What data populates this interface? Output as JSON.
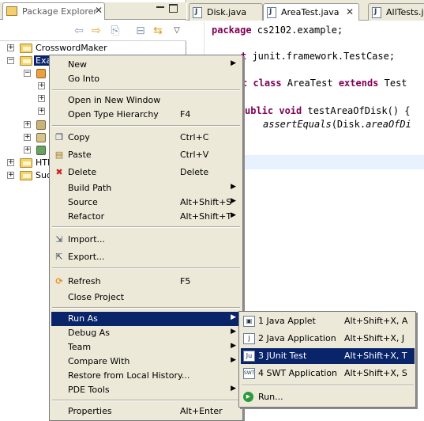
{
  "package_explorer": {
    "tab_label": "Package Explorer",
    "close_glyph": "✕",
    "toolbar_icons": [
      "back-arrow-icon",
      "forward-arrow-icon",
      "up-icon",
      "collapse-all-icon",
      "link-editor-icon",
      "view-menu-icon"
    ],
    "tree": [
      {
        "label": "CrosswordMaker",
        "expand": "+"
      },
      {
        "label": "Exa",
        "expand": "−",
        "selected": true
      },
      {
        "label": "HTD",
        "expand": "+"
      },
      {
        "label": "Suc",
        "expand": "+"
      }
    ]
  },
  "editor": {
    "tabs": [
      {
        "label": "Disk.java"
      },
      {
        "label": "AreaTest.java",
        "active": true,
        "close": "✕"
      },
      {
        "label": "AllTests.ja"
      }
    ],
    "code": {
      "line1_kw": "package",
      "line1_rest": " cs2102.example;",
      "line2_kw": "t",
      "line2_rest": " junit.framework.TestCase;",
      "line3_kw": "c class",
      "line3_mid": " AreaTest ",
      "line3_kw2": "extends",
      "line3_rest": " Test",
      "line4_kw": "ublic void",
      "line4_rest": " testAreaOfDisk() {",
      "line5_it": "assertEquals",
      "line5_rest": "(Disk.",
      "line5_it2": "areaOfDi"
    }
  },
  "context_menu": {
    "items": [
      {
        "label": "New",
        "submenu": true
      },
      {
        "label": "Go Into"
      },
      {
        "label": "Open in New Window"
      },
      {
        "label": "Open Type Hierarchy",
        "accel": "F4"
      },
      {
        "label": "Copy",
        "accel": "Ctrl+C",
        "icon": "copy-icon"
      },
      {
        "label": "Paste",
        "accel": "Ctrl+V",
        "icon": "paste-icon"
      },
      {
        "label": "Delete",
        "accel": "Delete",
        "icon": "delete-icon"
      },
      {
        "label": "Build Path",
        "submenu": true
      },
      {
        "label": "Source",
        "accel": "Alt+Shift+S",
        "submenu": true
      },
      {
        "label": "Refactor",
        "accel": "Alt+Shift+T",
        "submenu": true
      },
      {
        "label": "Import...",
        "icon": "import-icon"
      },
      {
        "label": "Export...",
        "icon": "export-icon"
      },
      {
        "label": "Refresh",
        "accel": "F5",
        "icon": "refresh-icon"
      },
      {
        "label": "Close Project"
      },
      {
        "label": "Run As",
        "submenu": true,
        "highlighted": true
      },
      {
        "label": "Debug As",
        "submenu": true
      },
      {
        "label": "Team",
        "submenu": true
      },
      {
        "label": "Compare With",
        "submenu": true
      },
      {
        "label": "Restore from Local History..."
      },
      {
        "label": "PDE Tools",
        "submenu": true
      },
      {
        "label": "Properties",
        "accel": "Alt+Enter"
      }
    ],
    "arrow_glyph": "▶",
    "copy_glyph": "❐",
    "paste_glyph": "▤",
    "delete_glyph": "✖",
    "import_glyph": "⇲",
    "export_glyph": "⇱",
    "refresh_glyph": "⟳"
  },
  "run_as_submenu": {
    "items": [
      {
        "label": "1 Java Applet",
        "accel": "Alt+Shift+X, A",
        "icon_text": "▣"
      },
      {
        "label": "2 Java Application",
        "accel": "Alt+Shift+X, J",
        "icon_text": "J"
      },
      {
        "label": "3 JUnit Test",
        "accel": "Alt+Shift+X, T",
        "icon_text": "Ju",
        "highlighted": true
      },
      {
        "label": "4 SWT Application",
        "accel": "Alt+Shift+X, S",
        "icon_text": "SWT"
      },
      {
        "label": "Run...",
        "icon_text": "▶"
      }
    ]
  },
  "colors": {
    "selection": "#0a246a",
    "menu_bg": "#ece9d8",
    "keyword": "#7f0055"
  }
}
